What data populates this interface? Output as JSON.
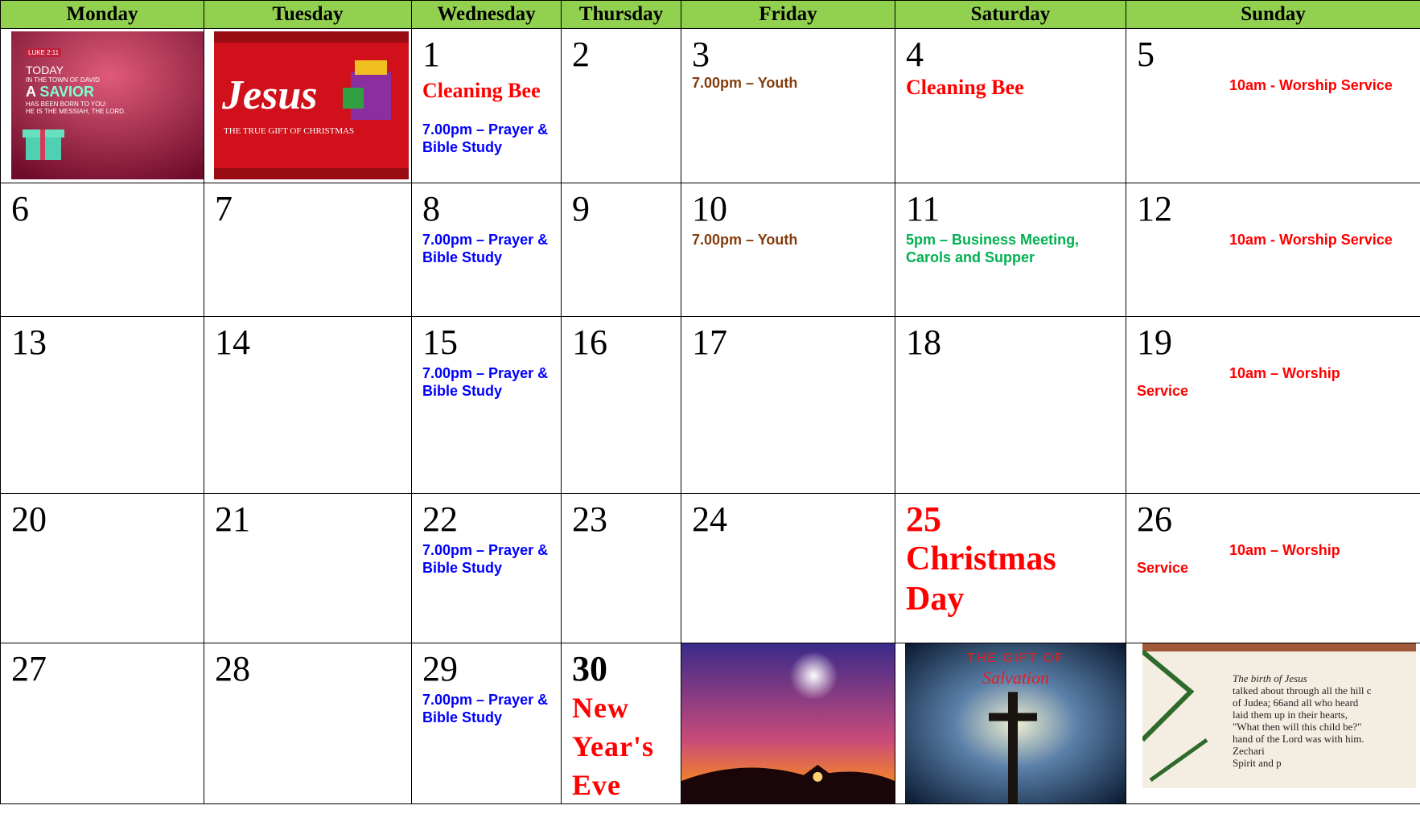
{
  "days_of_week": [
    "Monday",
    "Tuesday",
    "Wednesday",
    "Thursday",
    "Friday",
    "Saturday",
    "Sunday"
  ],
  "images": {
    "luke": {
      "verse": "LUKE 2:11",
      "l1": "TODAY",
      "l2": "IN THE TOWN OF DAVID",
      "l3": "A",
      "l4": "SAVIOR",
      "l5": "HAS BEEN BORN TO YOU:",
      "l6": "HE IS THE MESSIAH, THE LORD."
    },
    "jesus": {
      "word": "Jesus",
      "tag": "THE TRUE GIFT OF CHRISTMAS"
    },
    "salvation": {
      "l1": "THE GIFT OF",
      "l2": "Salvation"
    },
    "bible": {
      "heading": "The birth of Jesus",
      "t1": "talked about through all the hill c",
      "t2": "of Judea; 66and all who heard",
      "t3": "laid them up in their hearts,",
      "t4": "\"What then will this child be?\"",
      "t5": "hand of the Lord was with him.",
      "t6": "Zechari",
      "t7": "Spirit and p"
    }
  },
  "cells": {
    "d1": "1",
    "d2": "2",
    "d3": "3",
    "d4": "4",
    "d5": "5",
    "d6": "6",
    "d7": "7",
    "d8": "8",
    "d9": "9",
    "d10": "10",
    "d11": "11",
    "d12": "12",
    "d13": "13",
    "d14": "14",
    "d15": "15",
    "d16": "16",
    "d17": "17",
    "d18": "18",
    "d19": "19",
    "d20": "20",
    "d21": "21",
    "d22": "22",
    "d23": "23",
    "d24": "24",
    "d25": "25",
    "d26": "26",
    "d27": "27",
    "d28": "28",
    "d29": "29",
    "d30": "30"
  },
  "events": {
    "cleaning_bee": "Cleaning Bee",
    "prayer_l1": "7.00pm – Prayer &",
    "prayer_l2": "Bible Study",
    "youth": "7.00pm – Youth",
    "worship_full": "10am - Worship Service",
    "worship_short": "10am – Worship",
    "service": "Service",
    "business_l1": "5pm – Business Meeting,",
    "business_l2": "Carols and Supper",
    "christmas_l1": "Christmas",
    "christmas_l2": "Day",
    "nye_l1": "New",
    "nye_l2": "Year's",
    "nye_l3": "Eve"
  },
  "colors": {
    "header_bg": "#92d050",
    "blue": "#0000ff",
    "red": "#ff0000",
    "brown": "#843c0c",
    "green": "#00b050"
  }
}
